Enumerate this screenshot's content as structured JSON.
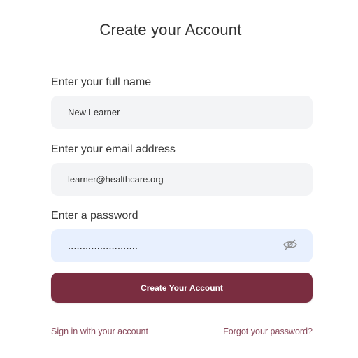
{
  "header": {
    "title": "Create your Account"
  },
  "form": {
    "name": {
      "label": "Enter your full name",
      "value": "New Learner"
    },
    "email": {
      "label": "Enter your email address",
      "value": "learner@healthcare.org"
    },
    "password": {
      "label": "Enter a password",
      "value": "........................",
      "toggle_icon": "eye-slash-icon"
    },
    "submit_label": "Create Your Account"
  },
  "links": {
    "sign_in": "Sign in with your account",
    "forgot": "Forgot your password?"
  },
  "colors": {
    "accent": "#7a2d40",
    "link": "#8a4b5c",
    "input_bg": "#f3f4f6",
    "input_focus_bg": "#e8f0fe"
  }
}
